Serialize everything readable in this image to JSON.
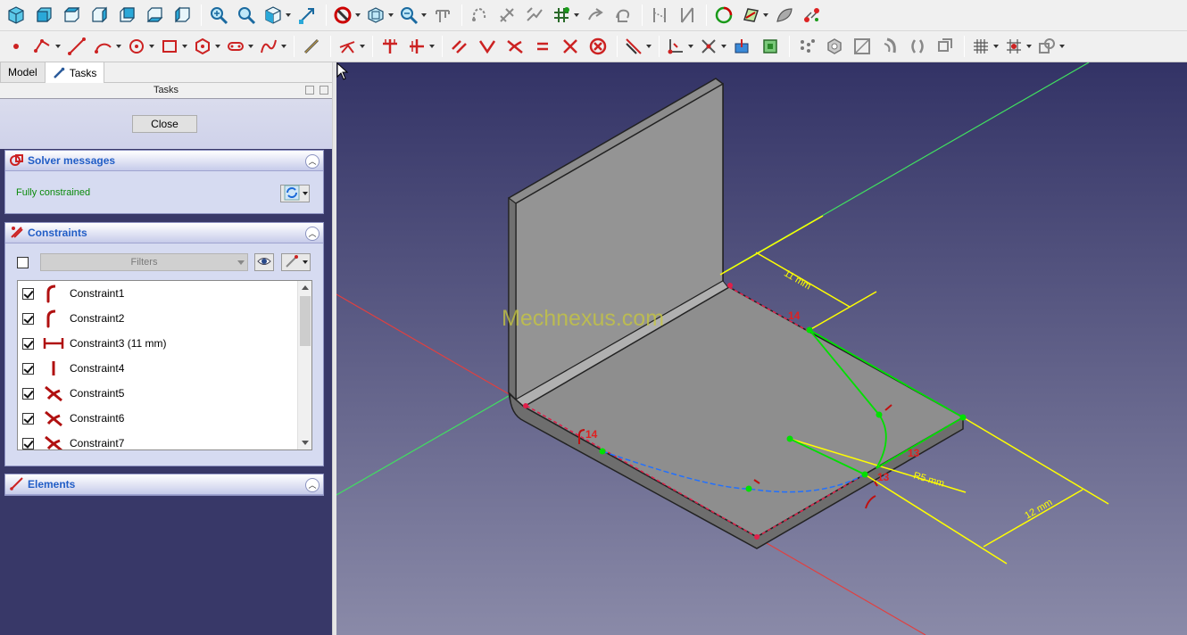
{
  "toolbar_top": {
    "icons": [
      "view-isometric-icon",
      "view-front-icon",
      "view-top-icon",
      "view-right-icon",
      "view-rear-icon",
      "view-bottom-icon",
      "view-left-icon",
      "zoom-fit-all-icon",
      "zoom-selection-icon",
      "standard-views-menu-icon",
      "measure-distance-icon",
      "draw-style-icon",
      "bounding-box-icon",
      "zoom-menu-icon",
      "measure-icon",
      "sketch-create-icon",
      "sketch-attach-icon",
      "validate-sketch-icon",
      "merge-sketches-icon",
      "sketch-mirror-icon",
      "reorient-sketch-icon",
      "view-section-icon",
      "view-sketch-icon",
      "leave-sketch-icon",
      "map-sketch-icon",
      "reorient-icon",
      "clone-icon"
    ]
  },
  "toolbar_sketch": {
    "icons": [
      "point-icon",
      "polyline-icon",
      "line-icon",
      "arc-icon",
      "circle-icon",
      "rectangle-icon",
      "polygon-icon",
      "slot-icon",
      "bspline-icon",
      "external-geometry-icon",
      "fillet-icon",
      "trim-icon",
      "extend-icon",
      "split-icon",
      "horizontal-constraint-icon",
      "vertical-constraint-icon",
      "parallel-constraint-icon",
      "perpendicular-constraint-icon",
      "tangent-constraint-icon",
      "equal-constraint-icon",
      "symmetric-constraint-icon",
      "block-constraint-icon",
      "distance-constraint-icon",
      "coincident-constraint-icon",
      "point-on-object-icon",
      "toggle-construction-icon",
      "dimension-icon",
      "bspline-degree-icon",
      "sketch-array-icon",
      "symmetry-icon",
      "clone-icon",
      "copy-icon",
      "move-icon",
      "rectangular-array-icon",
      "grid-icon",
      "snap-icon",
      "render-order-icon"
    ]
  },
  "tabs": {
    "model": "Model",
    "tasks": "Tasks"
  },
  "tasks_header": "Tasks",
  "close_button": "Close",
  "solver_panel": {
    "title": "Solver messages",
    "status": "Fully constrained",
    "status_color": "#0a8a0a"
  },
  "constraints_panel": {
    "title": "Constraints",
    "filter_placeholder": "Filters",
    "items": [
      {
        "label": "Constraint1",
        "icon": "tangent-arc-constraint-icon",
        "checked": true
      },
      {
        "label": "Constraint2",
        "icon": "tangent-arc-constraint-icon",
        "checked": true
      },
      {
        "label": "Constraint3 (11 mm)",
        "icon": "horizontal-distance-icon",
        "checked": true
      },
      {
        "label": "Constraint4",
        "icon": "vertical-constraint-icon",
        "checked": true
      },
      {
        "label": "Constraint5",
        "icon": "tangent-constraint-icon",
        "checked": true
      },
      {
        "label": "Constraint6",
        "icon": "tangent-constraint-icon",
        "checked": true
      },
      {
        "label": "Constraint7",
        "icon": "tangent-constraint-icon",
        "checked": true
      }
    ]
  },
  "elements_panel": {
    "title": "Elements"
  },
  "viewport": {
    "watermark": "Mechnexus.com",
    "dimensions": [
      "11 mm",
      "12 mm",
      "R5 mm"
    ],
    "constraint_labels": [
      "14",
      "14",
      "13",
      "13"
    ],
    "colors": {
      "bg_top": "#333366",
      "bg_bottom": "#8a8aa8",
      "axis_x": "#e04040",
      "axis_y": "#40e060",
      "dimension": "#ffff00",
      "construction": "#00e000",
      "edge_constraint": "#e0204a",
      "curve": "#2070ff"
    }
  }
}
